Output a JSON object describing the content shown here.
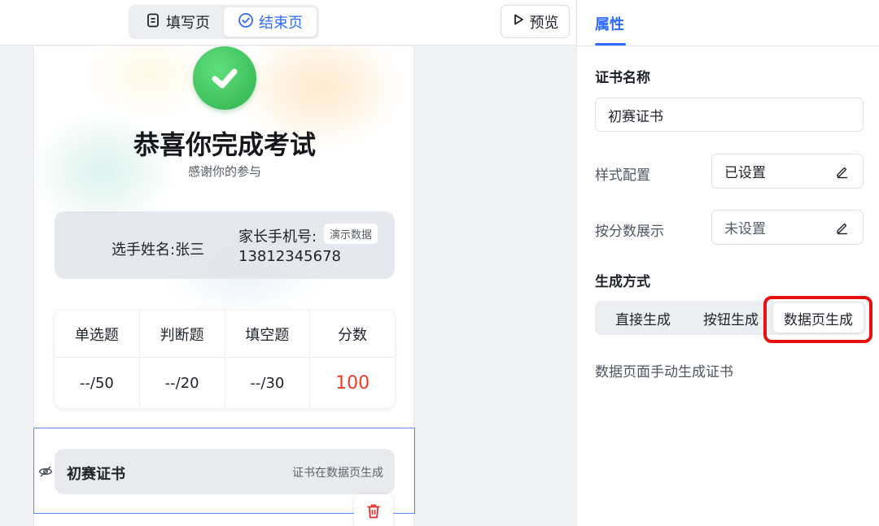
{
  "topbar": {
    "tabs": [
      {
        "label": "填写页",
        "icon": "form-icon",
        "active": false
      },
      {
        "label": "结束页",
        "icon": "check-circle-icon",
        "active": true
      }
    ],
    "preview_label": "预览"
  },
  "end_page": {
    "title": "恭喜你完成考试",
    "subtitle": "感谢你的参与",
    "info": {
      "name_text": "选手姓名:张三",
      "phone_label": "家长手机号:",
      "phone_value": "13812345678",
      "demo_tag": "演示数据"
    },
    "score_table": {
      "headers": [
        "单选题",
        "判断题",
        "填空题",
        "分数"
      ],
      "values": [
        "--/50",
        "--/20",
        "--/30",
        "100"
      ]
    },
    "certificate": {
      "name": "初赛证书",
      "hint": "证书在数据页生成"
    }
  },
  "panel": {
    "tab_label": "属性",
    "cert_name_label": "证书名称",
    "cert_name_value": "初赛证书",
    "style_config": {
      "label": "样式配置",
      "value": "已设置"
    },
    "score_display": {
      "label": "按分数展示",
      "value": "未设置"
    },
    "method_label": "生成方式",
    "methods": [
      {
        "label": "直接生成",
        "active": false
      },
      {
        "label": "按钮生成",
        "active": false
      },
      {
        "label": "数据页生成",
        "active": true
      }
    ],
    "method_desc": "数据页面手动生成证书"
  },
  "colors": {
    "accent": "#2f6bff",
    "score_highlight": "#ef3b24",
    "success": "#2fb14f",
    "annotation": "#e8100f"
  }
}
